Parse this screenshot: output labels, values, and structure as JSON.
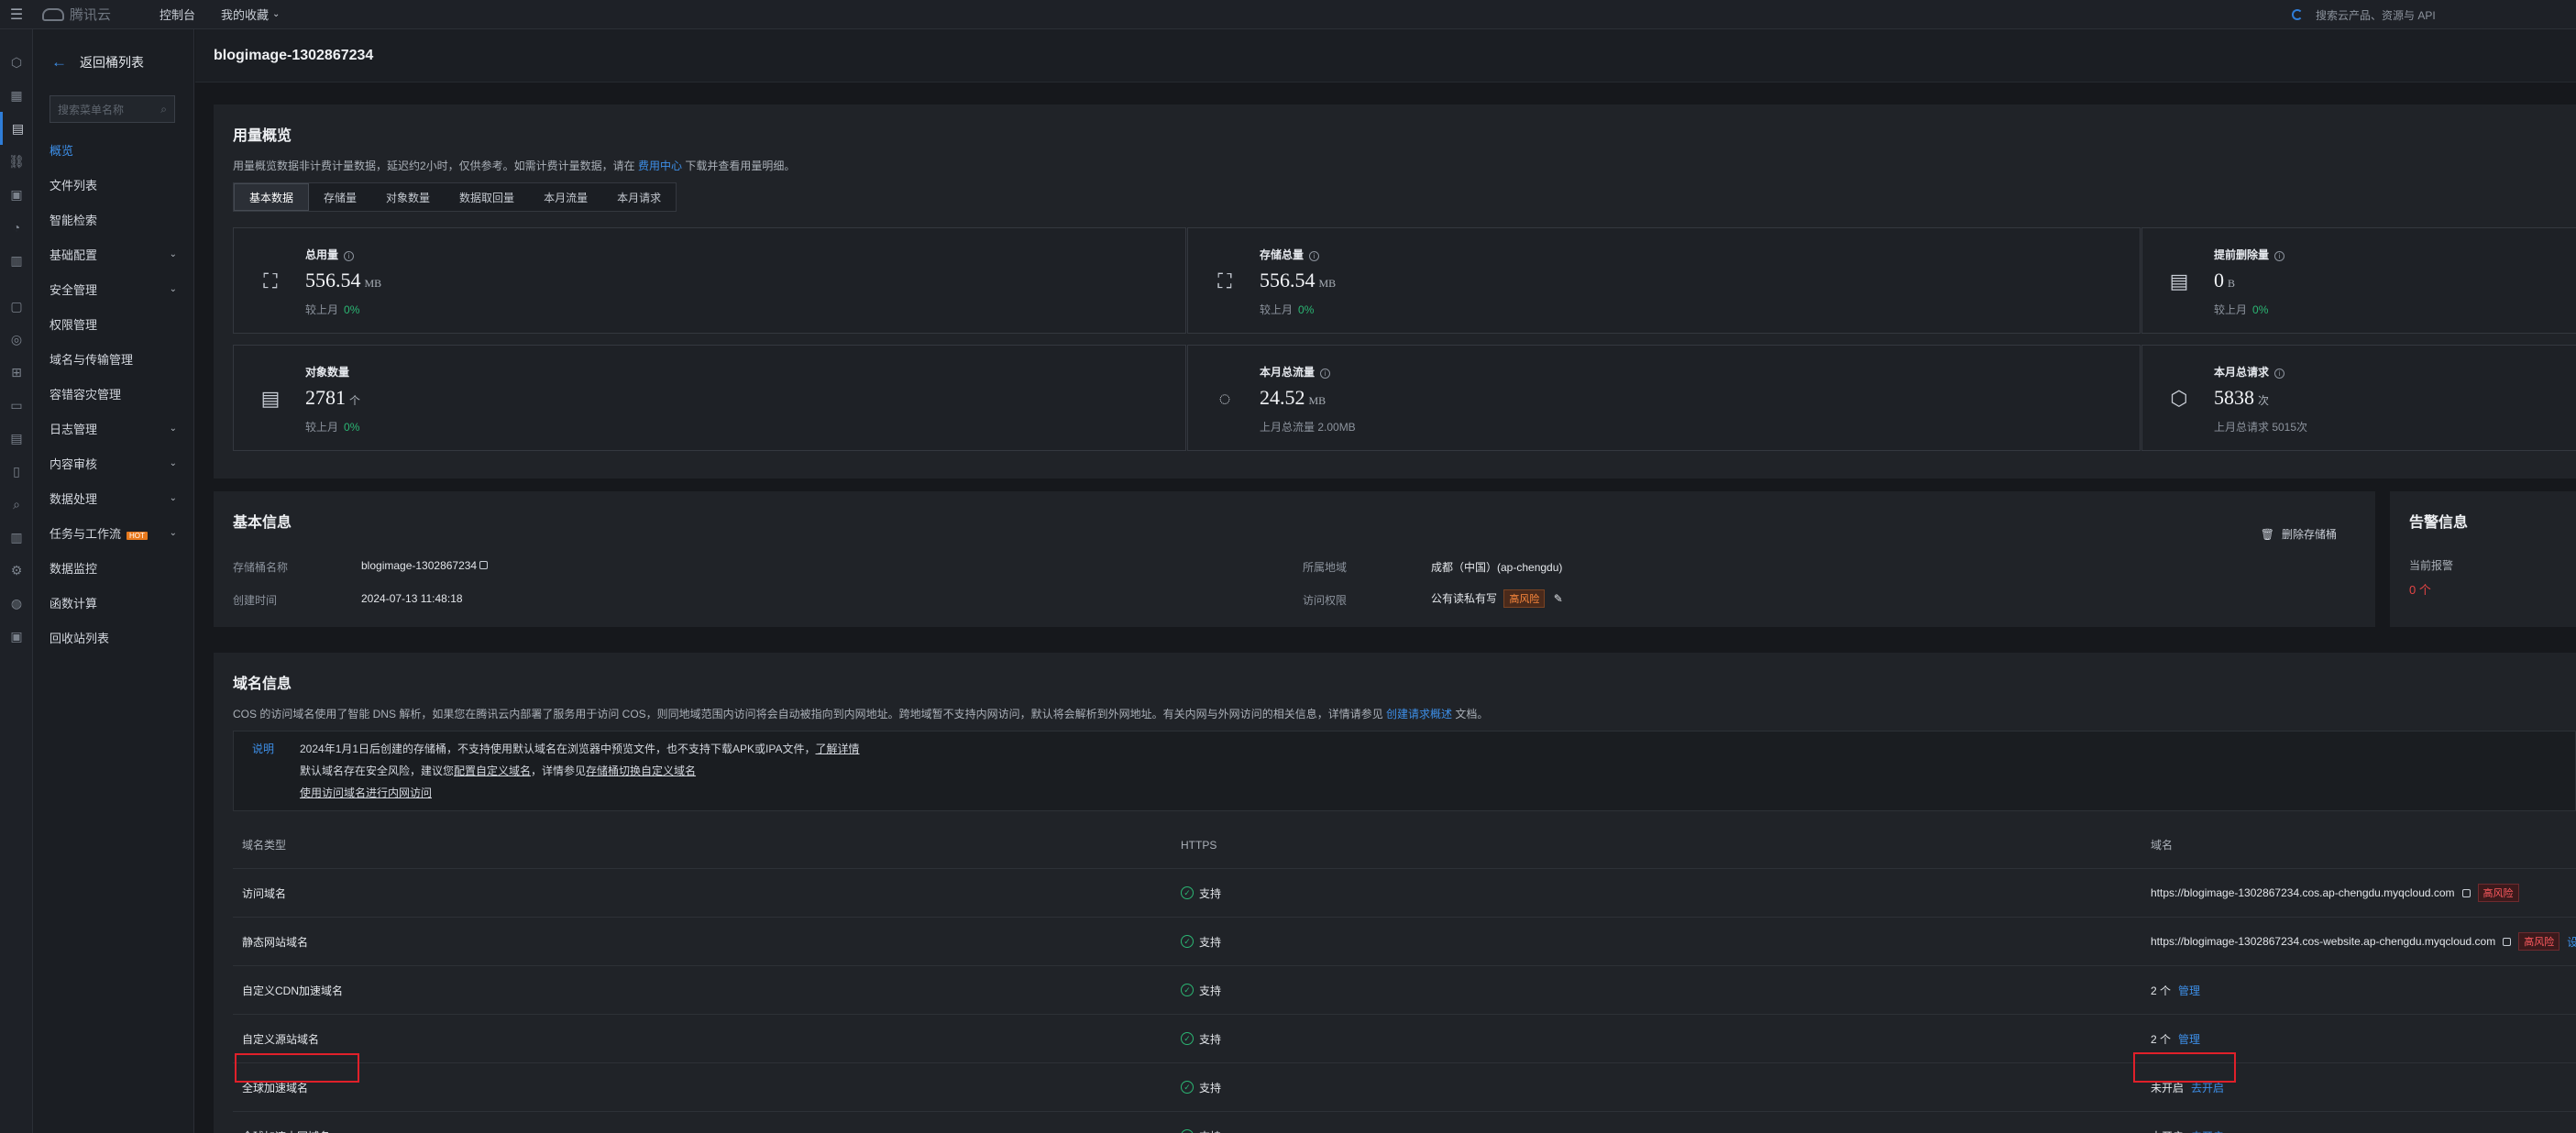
{
  "topbar": {
    "logo": "腾讯云",
    "console": "控制台",
    "favorites": "我的收藏",
    "search_placeholder": "搜索云产品、资源与 API"
  },
  "leftnav": {
    "back": "返回桶列表",
    "search_placeholder": "搜索菜单名称",
    "items": [
      {
        "label": "概览",
        "active": true,
        "chevron": false
      },
      {
        "label": "文件列表",
        "chevron": false
      },
      {
        "label": "智能检索",
        "chevron": false
      },
      {
        "label": "基础配置",
        "chevron": true
      },
      {
        "label": "安全管理",
        "chevron": true
      },
      {
        "label": "权限管理",
        "chevron": false
      },
      {
        "label": "域名与传输管理",
        "chevron": false
      },
      {
        "label": "容错容灾管理",
        "chevron": false
      },
      {
        "label": "日志管理",
        "chevron": true
      },
      {
        "label": "内容审核",
        "chevron": true
      },
      {
        "label": "数据处理",
        "chevron": true
      },
      {
        "label": "任务与工作流",
        "chevron": true,
        "badge": "HOT"
      },
      {
        "label": "数据监控",
        "chevron": false
      },
      {
        "label": "函数计算",
        "chevron": false
      },
      {
        "label": "回收站列表",
        "chevron": false
      }
    ]
  },
  "page": {
    "title": "blogimage-1302867234"
  },
  "usage": {
    "title": "用量概览",
    "desc_prefix": "用量概览数据非计费计量数据，延迟约2小时，仅供参考。如需计费计量数据，请在",
    "desc_link": "费用中心",
    "desc_suffix": "下载并查看用量明细。",
    "tabs": [
      "基本数据",
      "存储量",
      "对象数量",
      "数据取回量",
      "本月流量",
      "本月请求"
    ],
    "stats": [
      {
        "label": "总用量",
        "info": true,
        "value": "556.54",
        "unit": "MB",
        "sub": "较上月",
        "change": "0%"
      },
      {
        "label": "存储总量",
        "info": true,
        "value": "556.54",
        "unit": "MB",
        "sub": "较上月",
        "change": "0%"
      },
      {
        "label": "提前删除量",
        "info": true,
        "value": "0",
        "unit": "B",
        "sub": "较上月",
        "change": "0%"
      },
      {
        "label": "对象数量",
        "info": false,
        "value": "2781",
        "unit": "个",
        "sub": "较上月",
        "change": "0%"
      },
      {
        "label": "本月总流量",
        "info": true,
        "value": "24.52",
        "unit": "MB",
        "sub": "上月总流量 2.00MB",
        "change": ""
      },
      {
        "label": "本月总请求",
        "info": true,
        "value": "5838",
        "unit": "次",
        "sub": "上月总请求 5015次",
        "change": ""
      }
    ]
  },
  "basic": {
    "title": "基本信息",
    "delete": "删除存储桶",
    "bucket_name_label": "存储桶名称",
    "bucket_name": "blogimage-1302867234",
    "created_label": "创建时间",
    "created": "2024-07-13 11:48:18",
    "region_label": "所属地域",
    "region": "成都（中国）(ap-chengdu)",
    "acl_label": "访问权限",
    "acl": "公有读私有写",
    "acl_risk": "高风险"
  },
  "alarm": {
    "title": "告警信息",
    "current_label": "当前报警",
    "current_value": "0 个"
  },
  "domain": {
    "title": "域名信息",
    "desc_prefix": "COS 的访问域名使用了智能 DNS 解析，如果您在腾讯云内部署了服务用于访问 COS，则同地域范围内访问将会自动被指向到内网地址。跨地域暂不支持内网访问，默认将会解析到外网地址。有关内网与外网访问的相关信息，详情请参见",
    "desc_link": "创建请求概述",
    "desc_suffix": "文档。",
    "notice": {
      "tag": "说明",
      "line1": "2024年1月1日后创建的存储桶，不支持使用默认域名在浏览器中预览文件，也不支持下载APK或IPA文件，",
      "line1_link": "了解详情",
      "line2_a": "默认域名存在安全风险，建议您",
      "line2_link1": "配置自定义域名",
      "line2_b": "，详情参见",
      "line2_link2": "存储桶切换自定义域名",
      "line3_link": "使用访问域名进行内网访问"
    },
    "headers": [
      "域名类型",
      "HTTPS",
      "域名"
    ],
    "rows": [
      {
        "type": "访问域名",
        "https": "支持",
        "domain": "https://blogimage-1302867234.cos.ap-chengdu.myqcloud.com",
        "risk": "高风险",
        "action": ""
      },
      {
        "type": "静态网站域名",
        "https": "支持",
        "domain": "https://blogimage-1302867234.cos-website.ap-chengdu.myqcloud.com",
        "risk": "高风险",
        "action": "设置"
      },
      {
        "type": "自定义CDN加速域名",
        "https": "支持",
        "domain": "2 个",
        "risk": "",
        "action": "管理"
      },
      {
        "type": "自定义源站域名",
        "https": "支持",
        "domain": "2 个",
        "risk": "",
        "action": "管理"
      },
      {
        "type": "全球加速域名",
        "https": "支持",
        "domain": "未开启",
        "risk": "",
        "action": "去开启"
      },
      {
        "type": "全球加速内网域名",
        "https": "支持",
        "domain": "未开启",
        "risk": "",
        "action": "去开启"
      }
    ]
  }
}
